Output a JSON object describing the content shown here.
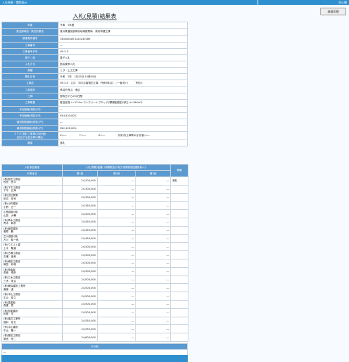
{
  "topbar": {
    "left": "入札結果／閲覧表示",
    "right": "再公開"
  },
  "print_button": "画面印刷",
  "title": "入札(見積)結果表",
  "info": [
    {
      "label": "年度",
      "value": "令和　5年度"
    },
    {
      "label": "発注部局名／発注所属名",
      "value": "奥州県建設部鳥羽地域振興局　鳥羽市建工課"
    },
    {
      "label": "調達案件番号",
      "value": "3300081874120230189"
    },
    {
      "label": "工事番号",
      "value": "―"
    },
    {
      "label": "工事番号年号",
      "value": "49‐1‐5"
    },
    {
      "label": "電子／紙",
      "value": "電子入札"
    },
    {
      "label": "入札方式",
      "value": "指名競争入札"
    },
    {
      "label": "業種",
      "value": "とび・土工工事"
    },
    {
      "label": "開札日時",
      "value": "令和　5年　1月25日 10時00分"
    },
    {
      "label": "工事名",
      "value": "49‐1‐5　公共　河川災害復旧工事（令和5年災）／一級河川　　　下松川"
    },
    {
      "label": "工事場所",
      "value": "鳥羽市西山　地区"
    },
    {
      "label": "工期",
      "value": "契約日から250日間"
    },
    {
      "label": "工事概要",
      "value": "復旧延長 L=37.0m コンクリートブロック(環境配慮型) 積工 A=180m2"
    },
    {
      "label": "予定価格(税抜)(円)",
      "value": "―"
    },
    {
      "label": "予定価格(税抜)(円)",
      "value": "¥24,830,000-"
    },
    {
      "label": "最低制限価格(税抜)(円)",
      "value": "―"
    },
    {
      "label": "最低制限価格(税抜)(円)",
      "value": "¥22,400,000-"
    },
    {
      "label": "ＸＹＺ(落札工事等の合計値)",
      "label2": "(該当する該当等の場合)",
      "value": "X＝―　　　　　Y＝―　　　　　Z＝―　　　　　次常(な工事等の合計値)＝―"
    },
    {
      "label": "摘要",
      "value": "落札"
    }
  ],
  "bid_table": {
    "h_company": "入札参加業者",
    "h_amount": "入札(見積)金額（消費税及び地方消費税相当額を除く）",
    "h_remark": "摘要",
    "h_name": "代表者名",
    "h_r1": "第1回",
    "h_r2": "第2回",
    "h_r3": "第3回",
    "rows": [
      {
        "c": "(株)秋田工務店",
        "p": "秋田　良平",
        "a1": "24,200,000",
        "a2": "―",
        "a3": "―",
        "r": "落札"
      },
      {
        "c": "(株)下平工務店",
        "p": "下平　広海",
        "a1": "24,300,000",
        "a2": "―",
        "a3": "―",
        "r": ""
      },
      {
        "c": "(株)田辺興業",
        "p": "田辺　宏司",
        "a1": "24,300,000",
        "a2": "―",
        "a3": "―",
        "r": ""
      },
      {
        "c": "(株)小町建設",
        "p": "小野　正一",
        "a1": "24,350,000",
        "a2": "―",
        "a3": "―",
        "r": ""
      },
      {
        "c": "山根建設(株)",
        "p": "山田　大輔",
        "a1": "24,400,000",
        "a2": "―",
        "a3": "―",
        "r": ""
      },
      {
        "c": "(有)青木工務店",
        "p": "青木　和彦",
        "a1": "24,450,000",
        "a2": "―",
        "a3": "―",
        "r": ""
      },
      {
        "c": "(株)菅原建設",
        "p": "菅原　勝",
        "a1": "24,450,000",
        "a2": "―",
        "a3": "―",
        "r": ""
      },
      {
        "c": "古川建設(株)",
        "p": "古川　昭一郎",
        "a1": "24,450,000",
        "a2": "―",
        "a3": "―",
        "r": ""
      },
      {
        "c": "(有)ウエスト建",
        "p": "上半　隆道",
        "a1": "24,500,000",
        "a2": "―",
        "a3": "―",
        "r": ""
      },
      {
        "c": "(株)古瀬工務店",
        "p": "古瀬　朋和",
        "a1": "24,500,000",
        "a2": "―",
        "a3": "―",
        "r": ""
      },
      {
        "c": "(有)織田工務店",
        "p": "織田　利雄",
        "a1": "24,500,000",
        "a2": "―",
        "a3": "―",
        "r": ""
      },
      {
        "c": "(株)角南組",
        "p": "角南　理彦",
        "a1": "24,500,000",
        "a2": "―",
        "a3": "―",
        "r": ""
      },
      {
        "c": "(株)三木工務店",
        "p": "三木　憲吉",
        "a1": "24,500,000",
        "a2": "―",
        "a3": "―",
        "r": ""
      },
      {
        "c": "(株)兼保建設工業所",
        "p": "兼保　進",
        "a1": "24,500,000",
        "a2": "―",
        "a3": "―",
        "r": ""
      },
      {
        "c": "(株)中山工務店",
        "p": "中山　倍之",
        "a1": "24,500,000",
        "a2": "―",
        "a3": "―",
        "r": ""
      },
      {
        "c": "(有)森重組",
        "p": "森重　寛",
        "a1": "24,500,000",
        "a2": "―",
        "a3": "―",
        "r": ""
      },
      {
        "c": "(株)松尾建設",
        "p": "松尾　学",
        "a1": "24,500,000",
        "a2": "―",
        "a3": "―",
        "r": ""
      },
      {
        "c": "(株)福井工業所",
        "p": "福井　宏文",
        "a1": "24,550,000",
        "a2": "―",
        "a3": "―",
        "r": ""
      },
      {
        "c": "(有)中山建設",
        "p": "中山　隆一",
        "a1": "24,550,000",
        "a2": "―",
        "a3": "―",
        "r": ""
      },
      {
        "c": "(株)藤田工務店",
        "p": "藤田　信二",
        "a1": "24,600,000",
        "a2": "―",
        "a3": "―",
        "r": ""
      }
    ]
  },
  "other": {
    "label": "その他",
    "value": "―"
  }
}
